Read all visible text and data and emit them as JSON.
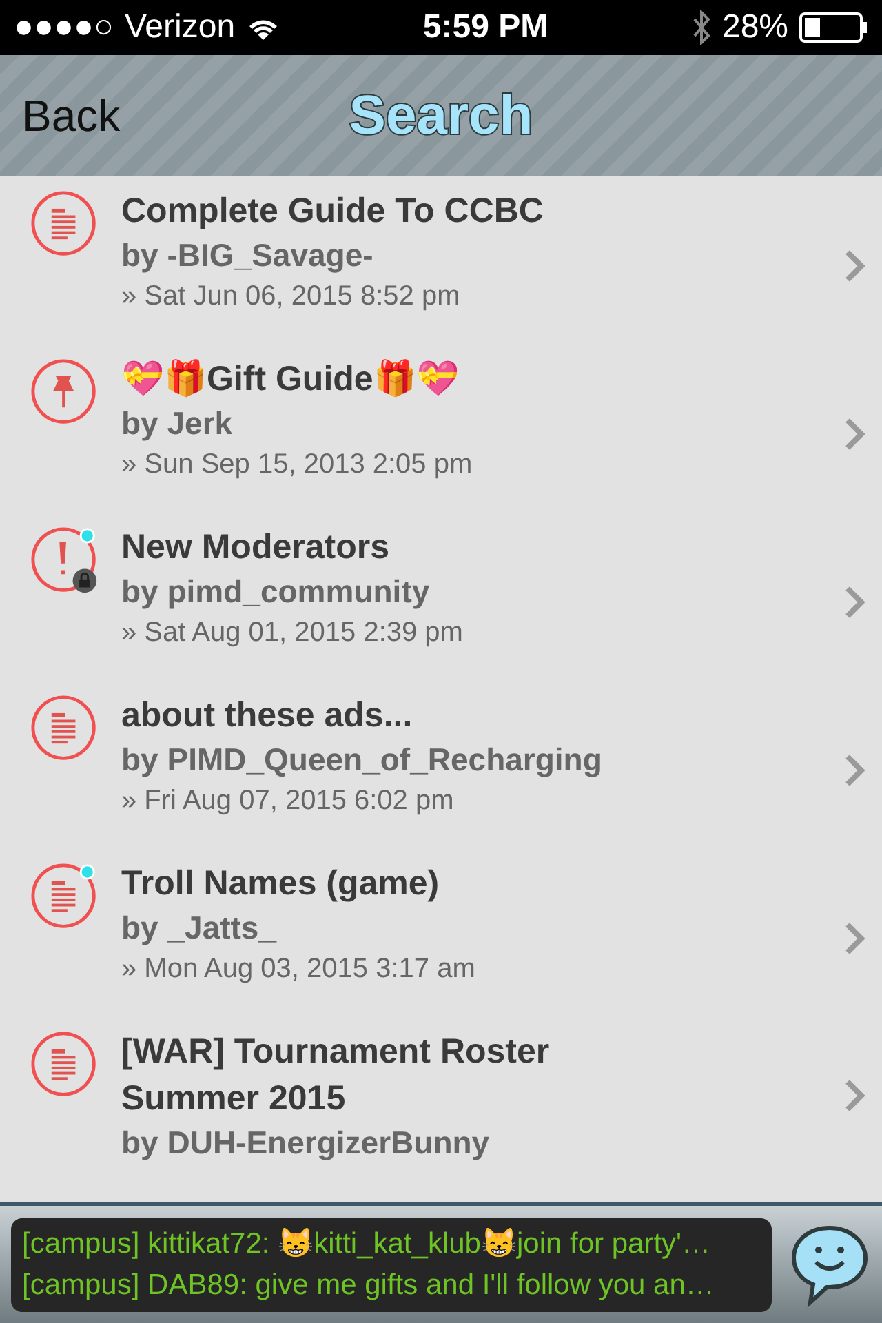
{
  "status_bar": {
    "signal_dots": "●●●●○",
    "carrier": "Verizon",
    "time": "5:59 PM",
    "battery": "28%"
  },
  "nav": {
    "back": "Back",
    "title": "Search"
  },
  "topics": [
    {
      "kind": "document",
      "unread": false,
      "locked": false,
      "title": "Complete Guide To CCBC",
      "author": "by -BIG_Savage-",
      "date": "» Sat Jun 06, 2015 8:52 pm"
    },
    {
      "kind": "pin",
      "unread": false,
      "locked": false,
      "title": "💝🎁Gift Guide🎁💝",
      "author": "by Jerk",
      "date": "» Sun Sep 15, 2013 2:05 pm"
    },
    {
      "kind": "alert",
      "unread": true,
      "locked": true,
      "title": "New Moderators",
      "author": "by pimd_community",
      "date": "» Sat Aug 01, 2015 2:39 pm"
    },
    {
      "kind": "document",
      "unread": false,
      "locked": false,
      "title": "about these ads...",
      "author": "by PIMD_Queen_of_Recharging",
      "date": "» Fri Aug 07, 2015 6:02 pm"
    },
    {
      "kind": "document",
      "unread": true,
      "locked": false,
      "title": "Troll Names (game)",
      "author": "by _Jatts_",
      "date": "» Mon Aug 03, 2015 3:17 am"
    },
    {
      "kind": "document",
      "unread": false,
      "locked": false,
      "title": "[WAR] Tournament Roster Summer 2015",
      "author": "by DUH-EnergizerBunny"
    }
  ],
  "chat": [
    "[campus] kittikat72: 😸kitti_kat_klub😸join for party'…",
    "[campus] DAB89: give me gifts and I'll follow you an…"
  ]
}
